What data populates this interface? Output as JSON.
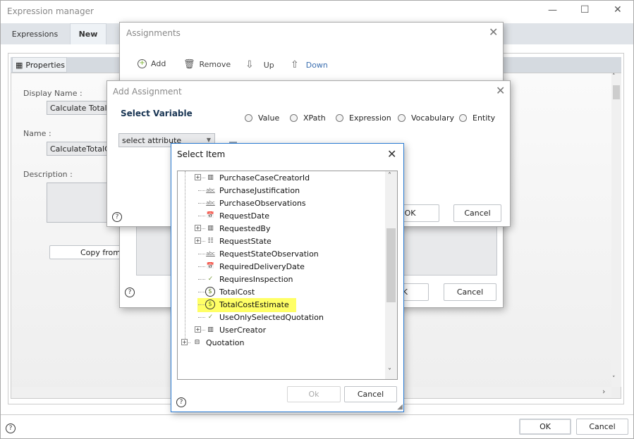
{
  "window": {
    "title": "Expression manager",
    "minimize": "—",
    "maximize": "☐",
    "close": "✕"
  },
  "tabs": [
    {
      "label": "Expressions",
      "active": false
    },
    {
      "label": "New",
      "active": true
    }
  ],
  "properties_tab": "Properties",
  "form": {
    "display_name_label": "Display Name :",
    "display_name_value": "Calculate Total C",
    "name_label": "Name :",
    "name_value": "CalculateTotalCo",
    "description_label": "Description :",
    "copy_from_label": "Copy from"
  },
  "footer": {
    "ok": "OK",
    "cancel": "Cancel",
    "help": "?"
  },
  "assignments": {
    "title": "Assignments",
    "toolbar": {
      "add": "Add",
      "remove": "Remove",
      "up": "Up",
      "down": "Down"
    },
    "ok": "OK",
    "cancel": "Cancel"
  },
  "add_assignment": {
    "title": "Add Assignment",
    "select_variable": "Select Variable",
    "radios": [
      "Value",
      "XPath",
      "Expression",
      "Vocabulary",
      "Entity"
    ],
    "select_value": "select attribute",
    "ok": "OK",
    "cancel": "Cancel"
  },
  "select_item": {
    "title": "Select Item",
    "ok": "Ok",
    "cancel": "Cancel",
    "selected": "TotalCostEstimate",
    "highlight_color": "#ffff66",
    "items": [
      {
        "label": "PurchaseCaseCreatorId",
        "icon": "entity-ref-icon",
        "expandable": true,
        "level": 2
      },
      {
        "label": "PurchaseJustification",
        "icon": "text-icon",
        "expandable": false,
        "level": 2
      },
      {
        "label": "PurchaseObservations",
        "icon": "text-icon",
        "expandable": false,
        "level": 2
      },
      {
        "label": "RequestDate",
        "icon": "date-icon",
        "expandable": false,
        "level": 2
      },
      {
        "label": "RequestedBy",
        "icon": "entity-ref-icon",
        "expandable": true,
        "level": 2
      },
      {
        "label": "RequestState",
        "icon": "list-icon",
        "expandable": true,
        "level": 2
      },
      {
        "label": "RequestStateObservation",
        "icon": "text-icon",
        "expandable": false,
        "level": 2
      },
      {
        "label": "RequiredDeliveryDate",
        "icon": "date-icon",
        "expandable": false,
        "level": 2
      },
      {
        "label": "RequiresInspection",
        "icon": "boolean-icon",
        "expandable": false,
        "level": 2
      },
      {
        "label": "TotalCost",
        "icon": "currency-icon",
        "expandable": false,
        "level": 2
      },
      {
        "label": "TotalCostEstimate",
        "icon": "currency-icon",
        "expandable": false,
        "level": 2
      },
      {
        "label": "UseOnlySelectedQuotation",
        "icon": "boolean-icon",
        "expandable": false,
        "level": 2
      },
      {
        "label": "UserCreator",
        "icon": "entity-ref-icon",
        "expandable": true,
        "level": 2
      },
      {
        "label": "Quotation",
        "icon": "entity-icon",
        "expandable": true,
        "level": 1
      }
    ]
  }
}
